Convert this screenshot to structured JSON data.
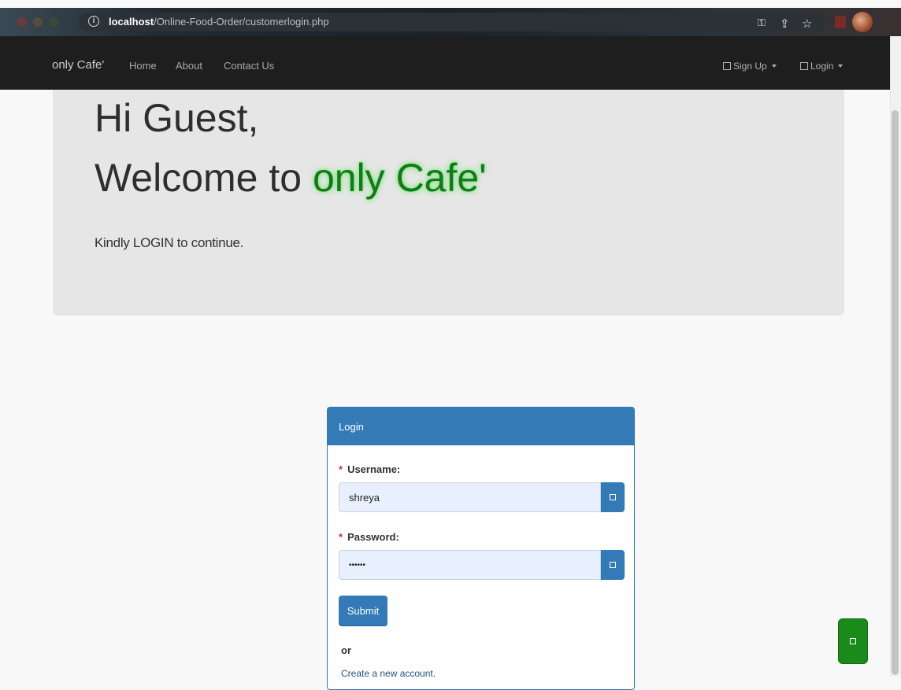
{
  "browser": {
    "url_host": "localhost",
    "url_path": "/Online-Food-Order/customerlogin.php"
  },
  "navbar": {
    "brand": "only Cafe'",
    "links": [
      "Home",
      "About",
      "Contact Us"
    ],
    "signup_label": "Sign Up",
    "login_label": "Login"
  },
  "hero": {
    "greeting": "Hi Guest,",
    "welcome_prefix": "Welcome to ",
    "brand": "only Cafe'",
    "subtitle": "Kindly LOGIN to continue."
  },
  "login": {
    "heading": "Login",
    "username_label": "Username:",
    "username_value": "shreya",
    "password_label": "Password:",
    "password_value": "••••••",
    "required_mark": "*",
    "submit_label": "Submit",
    "or_text": "or",
    "create_account_link": "Create a new account."
  },
  "colors": {
    "navbar_bg": "#1e1e1e",
    "primary": "#337ab7",
    "brand_green": "#127a18",
    "float_button": "#1a8a1a"
  }
}
